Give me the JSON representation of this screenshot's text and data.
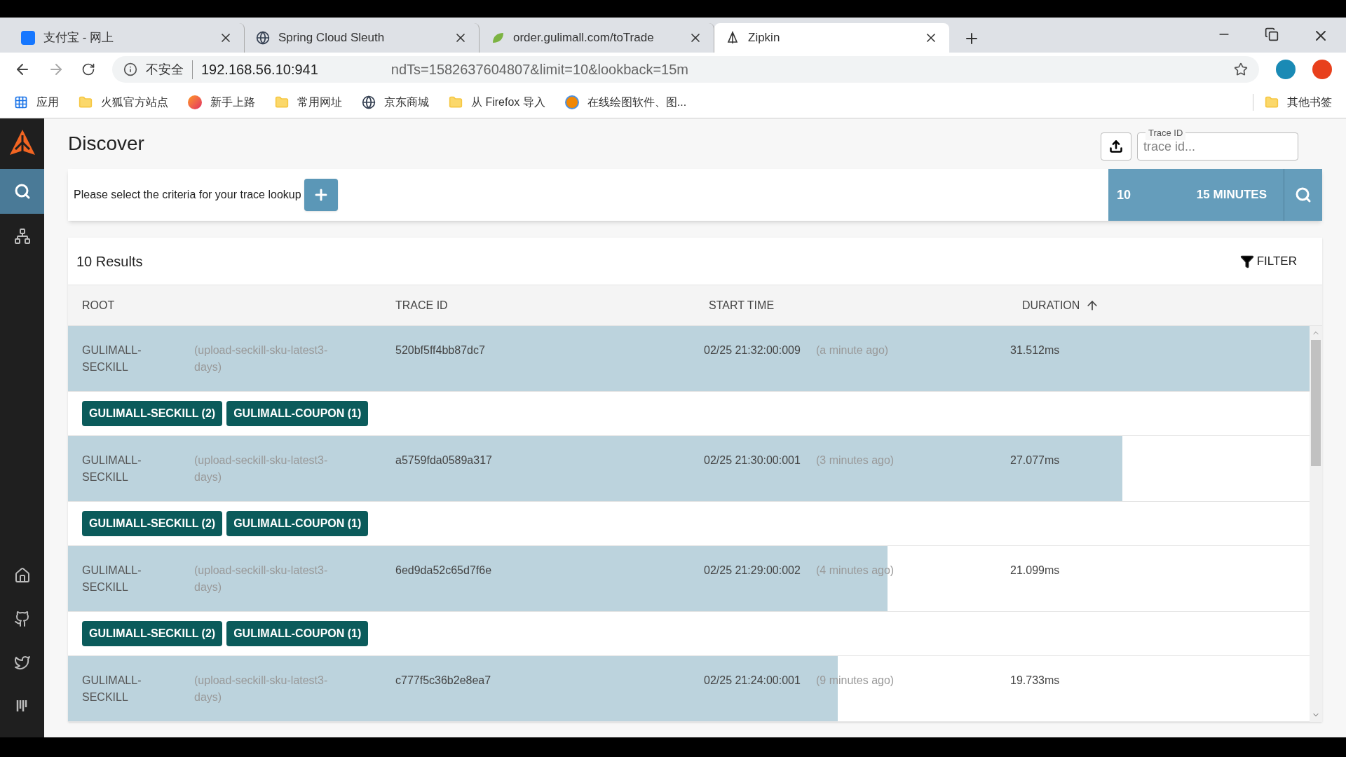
{
  "browser": {
    "tabs": [
      {
        "title": "支付宝 - 网上",
        "selected": false,
        "kind": "wallet"
      },
      {
        "title": "Spring Cloud Sleuth",
        "selected": false,
        "kind": "globe"
      },
      {
        "title": "order.gulimall.com/toTrade",
        "selected": false,
        "kind": "leaf"
      },
      {
        "title": "Zipkin",
        "selected": true,
        "kind": "pin"
      }
    ],
    "security": "不安全",
    "url_parts": [
      "192.168.56.10:941",
      "ndTs=1582637604807&limit=10&lookback=15m"
    ],
    "bookmarks": [
      {
        "label": "应用",
        "kind": "apps"
      },
      {
        "label": "火狐官方站点",
        "kind": "folder"
      },
      {
        "label": "新手上路",
        "kind": "browser"
      },
      {
        "label": "常用网址",
        "kind": "folder"
      },
      {
        "label": "京东商城",
        "kind": "globe"
      },
      {
        "label": "从 Firefox 导入",
        "kind": "folder"
      },
      {
        "label": "在线绘图软件、图...",
        "kind": "diagram"
      }
    ],
    "other_bookmarks": "其他书签"
  },
  "sidebar": {
    "items": [
      {
        "kind": "search",
        "selected": true
      },
      {
        "kind": "dependencies",
        "selected": false
      }
    ],
    "bottom": [
      {
        "kind": "home"
      },
      {
        "kind": "github"
      },
      {
        "kind": "twitter"
      },
      {
        "kind": "bars"
      }
    ]
  },
  "page": {
    "title": "Discover",
    "trace_id_label": "Trace ID",
    "trace_id_placeholder": "trace id...",
    "criteria": "Please select the criteria for your trace lookup",
    "limit": "10",
    "lookback": "15 MINUTES"
  },
  "results": {
    "count": "10 Results",
    "filter": "FILTER",
    "columns": [
      "ROOT",
      "TRACE ID",
      "START TIME",
      "DURATION"
    ],
    "rows": [
      {
        "service": "GULIMALL-SECKILL",
        "span": "(upload-seckill-sku-latest3-days)",
        "trace_id": "520bf5ff4bb87dc7",
        "start": "02/25 21:32:00:009",
        "ago": "(a minute ago)",
        "duration": "31.512ms",
        "level": 1.0,
        "tags": [
          "GULIMALL-SECKILL (2)",
          "GULIMALL-COUPON (1)"
        ]
      },
      {
        "service": "GULIMALL-SECKILL",
        "span": "(upload-seckill-sku-latest3-days)",
        "trace_id": "a5759fda0589a317",
        "start": "02/25 21:30:00:001",
        "ago": "(3 minutes ago)",
        "duration": "27.077ms",
        "level": 0.849,
        "tags": [
          "GULIMALL-SECKILL (2)",
          "GULIMALL-COUPON (1)"
        ]
      },
      {
        "service": "GULIMALL-SECKILL",
        "span": "(upload-seckill-sku-latest3-days)",
        "trace_id": "6ed9da52c65d7f6e",
        "start": "02/25 21:29:00:002",
        "ago": "(4 minutes ago)",
        "duration": "21.099ms",
        "level": 0.66,
        "tags": [
          "GULIMALL-SECKILL (2)",
          "GULIMALL-COUPON (1)"
        ]
      },
      {
        "service": "GULIMALL-SECKILL",
        "span": "(upload-seckill-sku-latest3-days)",
        "trace_id": "c777f5c36b2e8ea7",
        "start": "02/25 21:24:00:001",
        "ago": "(9 minutes ago)",
        "duration": "19.733ms",
        "level": 0.62
      }
    ]
  }
}
